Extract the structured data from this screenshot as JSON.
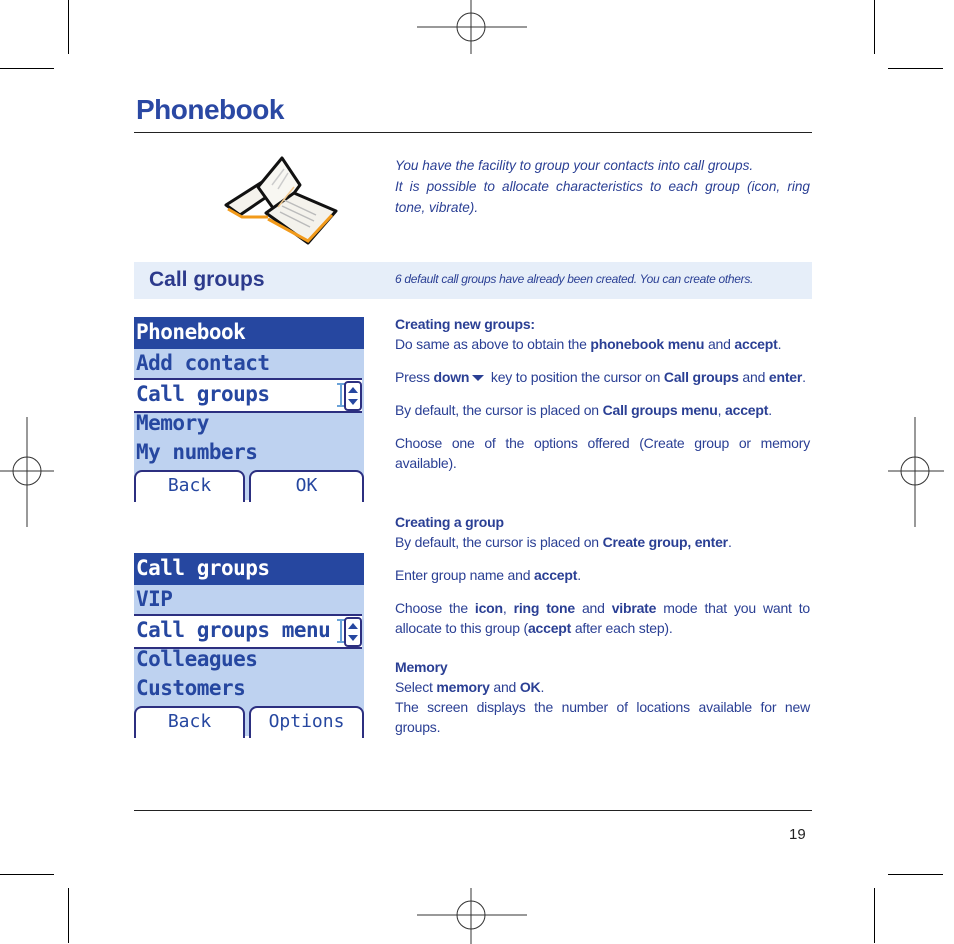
{
  "header": {
    "title": "Phonebook"
  },
  "intro": {
    "line1": "You have the facility to group your contacts into call groups.",
    "line2": "It is possible to allocate characteristics to each group (icon, ring tone, vibrate)."
  },
  "section": {
    "title": "Call groups",
    "note": "6 default call groups have already been created. You can create others."
  },
  "screens": [
    {
      "title": "Phonebook",
      "items": [
        "Add contact",
        "Call groups",
        "Memory",
        "My numbers"
      ],
      "selected_index": 1,
      "softkeys": {
        "left": "Back",
        "right": "OK"
      }
    },
    {
      "title": "Call groups",
      "items": [
        "VIP",
        "Call groups menu",
        "Colleagues",
        "Customers"
      ],
      "selected_index": 1,
      "softkeys": {
        "left": "Back",
        "right": "Options"
      }
    }
  ],
  "instructions": {
    "creating_new": {
      "heading": "Creating new groups:",
      "p1": {
        "t1": "Do same as above to obtain the ",
        "b1": "phonebook menu",
        "t2": " and ",
        "b2": "accept",
        "t3": "."
      },
      "p2": {
        "t1": "Press ",
        "b1": "down",
        "t2": " key to position the cursor on ",
        "b2": "Call groups",
        "t3": " and ",
        "b3": "enter",
        "t4": "."
      },
      "p3": {
        "t1": "By default, the cursor is placed on ",
        "b1": "Call groups menu",
        "t2": ", ",
        "b2": "accept",
        "t3": "."
      },
      "p4": {
        "t1": "Choose one of the options offered (Create group or memory available)."
      }
    },
    "creating_group": {
      "heading": "Creating a group",
      "p1": {
        "t1": "By default, the cursor is placed on ",
        "b1": "Create group, enter",
        "t2": "."
      },
      "p2": {
        "t1": "Enter group name and ",
        "b1": "accept",
        "t2": "."
      },
      "p3": {
        "t1": "Choose the ",
        "b1": "icon",
        "t2": ", ",
        "b2": "ring tone",
        "t3": " and ",
        "b3": "vibrate",
        "t4": " mode that you want to allocate to this group (",
        "b4": "accept",
        "t5": " after each step)."
      }
    },
    "memory": {
      "heading": "Memory",
      "p1": {
        "t1": "Select ",
        "b1": "memory",
        "t2": " and ",
        "b2": "OK",
        "t3": "."
      },
      "p2": {
        "t1": "The screen displays the number of locations available for new groups."
      }
    }
  },
  "footer": {
    "page_number": "19"
  },
  "icons": {
    "book": "open-book-icon",
    "down_key": "down-arrow-icon"
  }
}
